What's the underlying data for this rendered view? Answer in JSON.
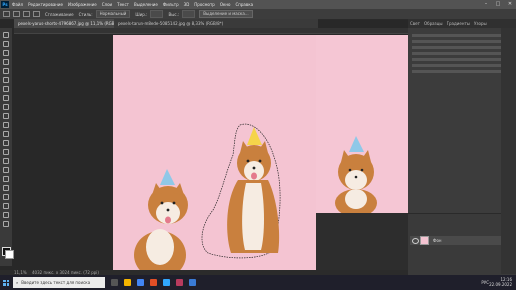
{
  "menubar": {
    "items": [
      "Файл",
      "Редактирование",
      "Изображение",
      "Слои",
      "Текст",
      "Выделение",
      "Фильтр",
      "3D",
      "Просмотр",
      "Окно",
      "Справка"
    ],
    "app_logo": "Ps"
  },
  "window_controls": {
    "minimize": "–",
    "maximize": "□",
    "close": "✕"
  },
  "options_bar": {
    "smoothing_label": "Сглаживание",
    "style_label": "Стиль:",
    "style_value": "Нормальный",
    "width_label": "Шир.:",
    "height_label": "Выс.:",
    "select_mask_button": "Выделение и маска..."
  },
  "tabs": [
    {
      "label": "pexels-yarus-shorts-4796867.jpg @ 11,1% (RGB/8*)"
    },
    {
      "label": "pexels-tarun-m8ede-5085142.jpg @ 8,33% (RGB/8*)"
    }
  ],
  "panel_tabs": [
    "Свет",
    "Образцы",
    "Градиенты",
    "Узоры"
  ],
  "layers": {
    "layer_name": "Фон"
  },
  "status_bar": {
    "zoom": "11,1%",
    "doc_info": "4032 пикс. x 3024 пикс. (72 ppi)"
  },
  "taskbar": {
    "search_placeholder": "Введите здесь текст для поиска",
    "language": "РУС",
    "time": "12:16",
    "date": "22.09.2022"
  },
  "colors": {
    "canvas_pink": "#f4c4d2",
    "ps_bg": "#282828",
    "panel": "#3c3c3c",
    "taskbar": "#1f1f2b"
  },
  "icons": [
    "photoshop-logo",
    "move-tool-icon",
    "marquee-tool-icon",
    "lasso-tool-icon",
    "crop-tool-icon",
    "brush-tool-icon",
    "eye-icon",
    "windows-start-icon",
    "search-icon"
  ]
}
